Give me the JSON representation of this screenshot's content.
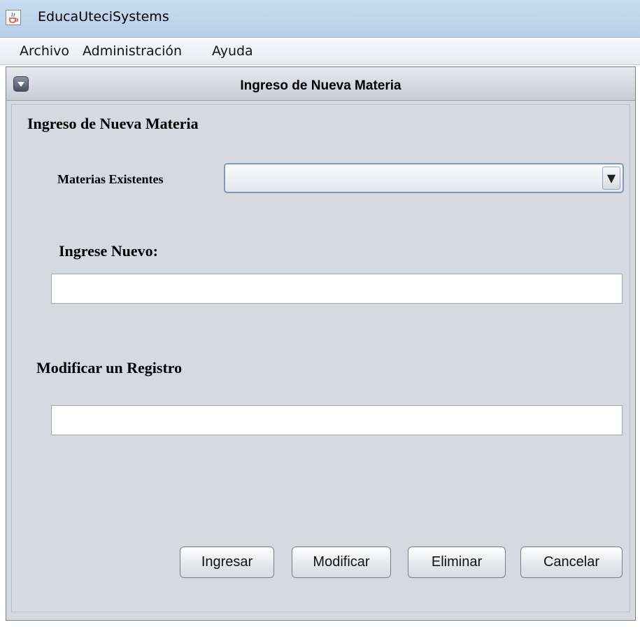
{
  "window": {
    "title": "EducaUteciSystems",
    "icon": "java-cup-icon"
  },
  "menubar": {
    "items": [
      {
        "label": "Archivo"
      },
      {
        "label": "Administración"
      },
      {
        "label": "Ayuda"
      }
    ]
  },
  "internal_frame": {
    "title": "Ingreso de Nueva Materia"
  },
  "form": {
    "heading": "Ingreso de Nueva Materia",
    "existing_label": "Materias Existentes",
    "existing_value": "",
    "new_label": "Ingrese Nuevo:",
    "new_value": "",
    "modify_label": "Modificar un Registro",
    "modify_value": ""
  },
  "buttons": {
    "ingresar": "Ingresar",
    "modificar": "Modificar",
    "eliminar": "Eliminar",
    "cancelar": "Cancelar"
  }
}
